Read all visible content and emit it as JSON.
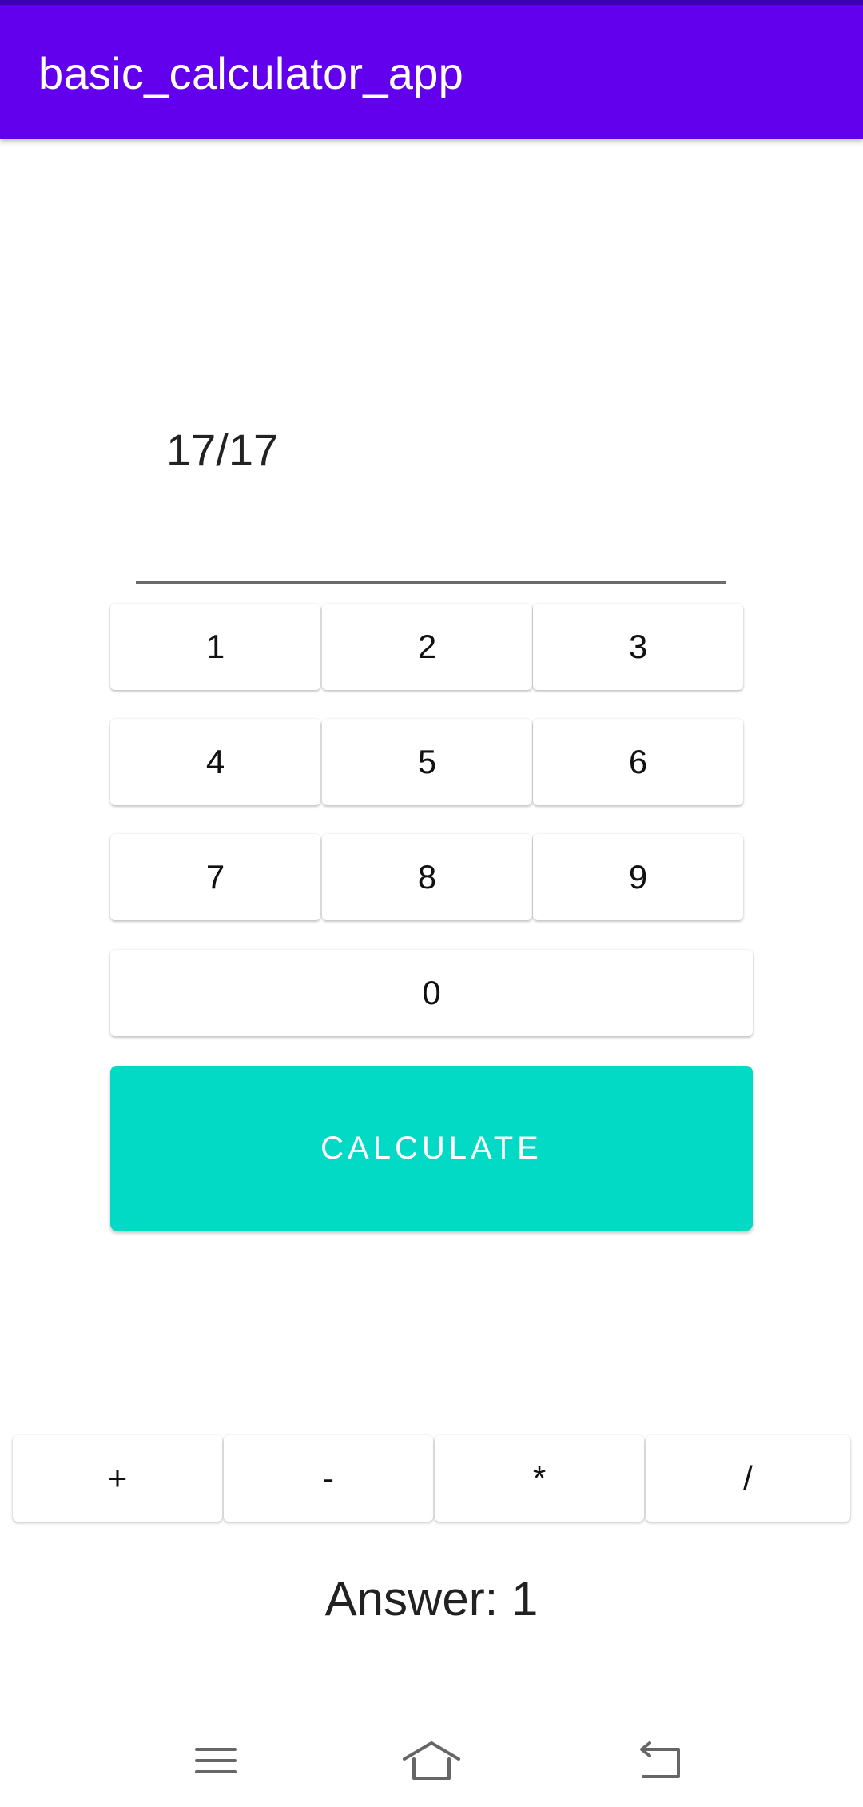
{
  "app_bar": {
    "title": "basic_calculator_app",
    "color": "#6200ee"
  },
  "expression": {
    "value": "17/17"
  },
  "digit_keys": [
    "1",
    "2",
    "3",
    "4",
    "5",
    "6",
    "7",
    "8",
    "9",
    "0"
  ],
  "calculate_button": {
    "label": "CALCULATE",
    "color": "#03dac5"
  },
  "operator_keys": [
    "+",
    "-",
    "*",
    "/"
  ],
  "answer": {
    "text": "Answer: 1"
  },
  "nav_bar": {
    "icons": [
      "menu-icon",
      "home-icon",
      "back-icon"
    ]
  }
}
